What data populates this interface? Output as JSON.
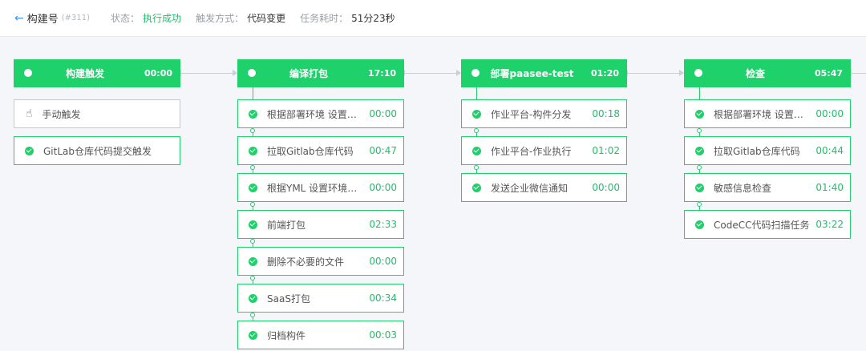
{
  "header": {
    "back_arrow": "←",
    "title": "构建号",
    "build_no": "(#311)",
    "status_label": "状态：",
    "status_value": "执行成功",
    "trigger_label": "触发方式：",
    "trigger_value": "代码变更",
    "duration_label": "任务耗时：",
    "duration_value": "51分23秒"
  },
  "stages": [
    {
      "name": "构建触发",
      "time": "00:00",
      "tasks": [
        {
          "name": "手动触发",
          "time": "",
          "type": "manual"
        },
        {
          "name": "GitLab仓库代码提交触发",
          "time": "",
          "type": "success"
        }
      ]
    },
    {
      "name": "编译打包",
      "time": "17:10",
      "tasks": [
        {
          "name": "根据部署环境 设置环境变量",
          "time": "00:00"
        },
        {
          "name": "拉取Gitlab仓库代码",
          "time": "00:47"
        },
        {
          "name": "根据YML 设置环境变量",
          "time": "00:00"
        },
        {
          "name": "前端打包",
          "time": "02:33"
        },
        {
          "name": "删除不必要的文件",
          "time": "00:00"
        },
        {
          "name": "SaaS打包",
          "time": "00:34"
        },
        {
          "name": "归档构件",
          "time": "00:03"
        }
      ]
    },
    {
      "name": "部署paasee-test",
      "time": "01:20",
      "tasks": [
        {
          "name": "作业平台-构件分发",
          "time": "00:18"
        },
        {
          "name": "作业平台-作业执行",
          "time": "01:02"
        },
        {
          "name": "发送企业微信通知",
          "time": "00:00"
        }
      ]
    },
    {
      "name": "检查",
      "time": "05:47",
      "tasks": [
        {
          "name": "根据部署环境 设置环境变量",
          "time": "00:00"
        },
        {
          "name": "拉取Gitlab仓库代码",
          "time": "00:44"
        },
        {
          "name": "敏感信息检查",
          "time": "01:40"
        },
        {
          "name": "CodeCC代码扫描任务",
          "time": "03:22"
        }
      ]
    }
  ],
  "colors": {
    "accent": "#1ed16b",
    "link": "#3c96ff"
  }
}
